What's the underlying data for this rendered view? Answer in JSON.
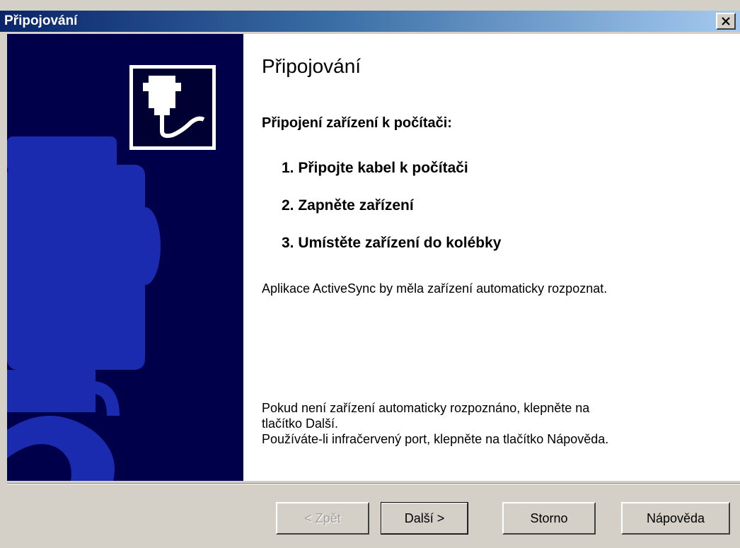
{
  "window": {
    "title": "Připojování"
  },
  "main": {
    "heading": "Připojování",
    "subheading": "Připojení zařízení k počítači:",
    "steps": [
      "1. Připojte kabel k počítači",
      "2. Zapněte zařízení",
      "3. Umístěte zařízení do kolébky"
    ],
    "info": "Aplikace ActiveSync by měla zařízení automaticky rozpoznat.",
    "note_line1": "Pokud není zařízení automaticky rozpoznáno, klepněte na",
    "note_line2": "tlačítko Další.",
    "note_line3": "Používáte-li infračervený port, klepněte na tlačítko Nápověda."
  },
  "buttons": {
    "back": "< Zpět",
    "next": "Další >",
    "cancel": "Storno",
    "help": "Nápověda"
  },
  "icons": {
    "close": "close-icon",
    "logo": "cable-connector-icon"
  },
  "colors": {
    "titlebar_start": "#0a246a",
    "titlebar_end": "#a6caf0",
    "sidepanel": "#00004a",
    "sidepanel_shapes": "#1a2bb0",
    "dialog_bg": "#d4d0c8"
  }
}
